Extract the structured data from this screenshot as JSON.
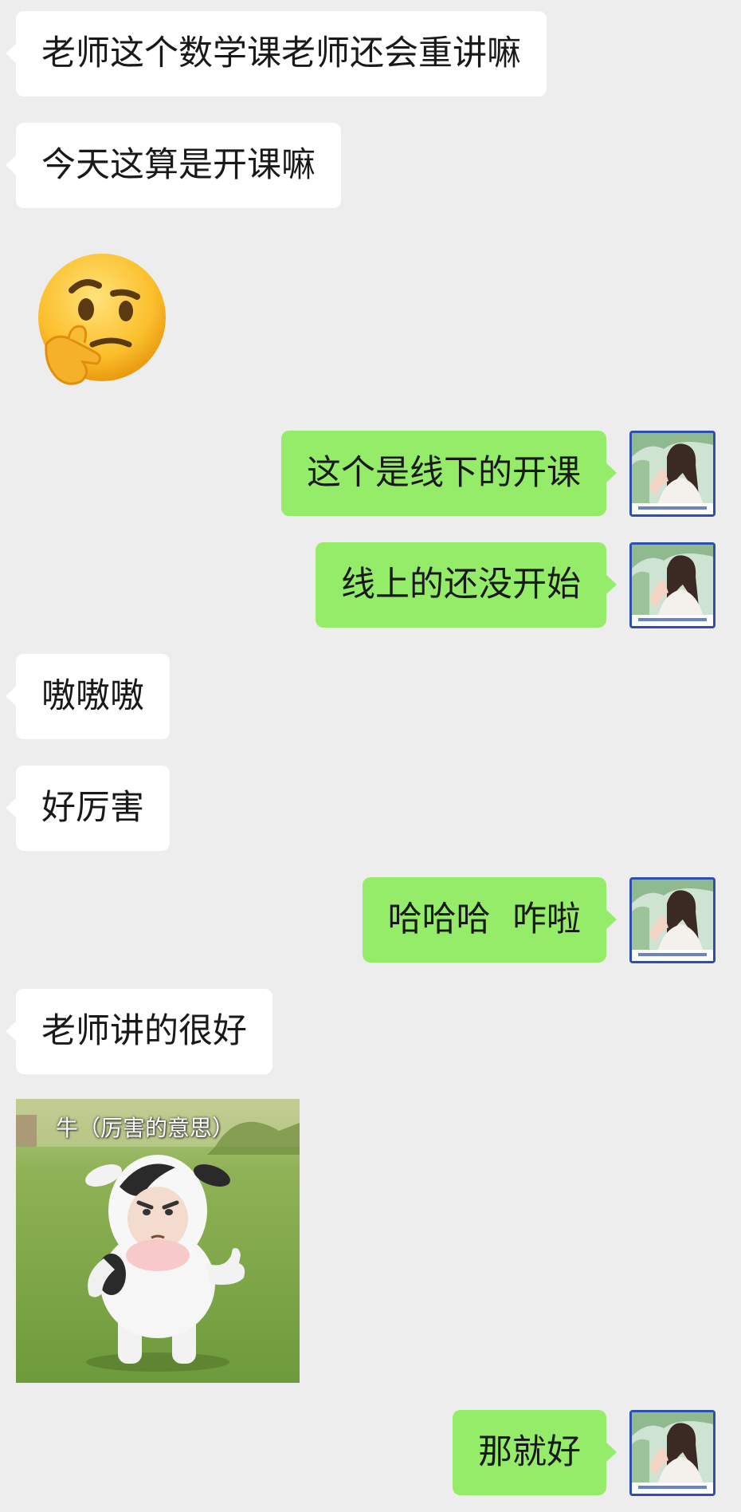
{
  "messages": [
    {
      "side": "left",
      "type": "text",
      "text": "老师这个数学课老师还会重讲嘛"
    },
    {
      "side": "left",
      "type": "text",
      "text": "今天这算是开课嘛"
    },
    {
      "side": "left",
      "type": "emoji",
      "emoji": "thinking-face"
    },
    {
      "side": "right",
      "type": "text",
      "text": "这个是线下的开课"
    },
    {
      "side": "right",
      "type": "text",
      "text": "线上的还没开始"
    },
    {
      "side": "left",
      "type": "text",
      "text": "嗷嗷嗷"
    },
    {
      "side": "left",
      "type": "text",
      "text": "好厉害"
    },
    {
      "side": "right",
      "type": "text",
      "text": "哈哈哈  咋啦"
    },
    {
      "side": "left",
      "type": "text",
      "text": "老师讲的很好"
    },
    {
      "side": "left",
      "type": "sticker",
      "caption": "牛（厉害的意思）",
      "sticker": "thumbs-up-cow"
    },
    {
      "side": "right",
      "type": "text",
      "text": "那就好"
    }
  ],
  "colors": {
    "background": "#ededed",
    "incoming_bubble": "#ffffff",
    "outgoing_bubble": "#95ec69",
    "avatar_frame": "#2f4fa8"
  }
}
